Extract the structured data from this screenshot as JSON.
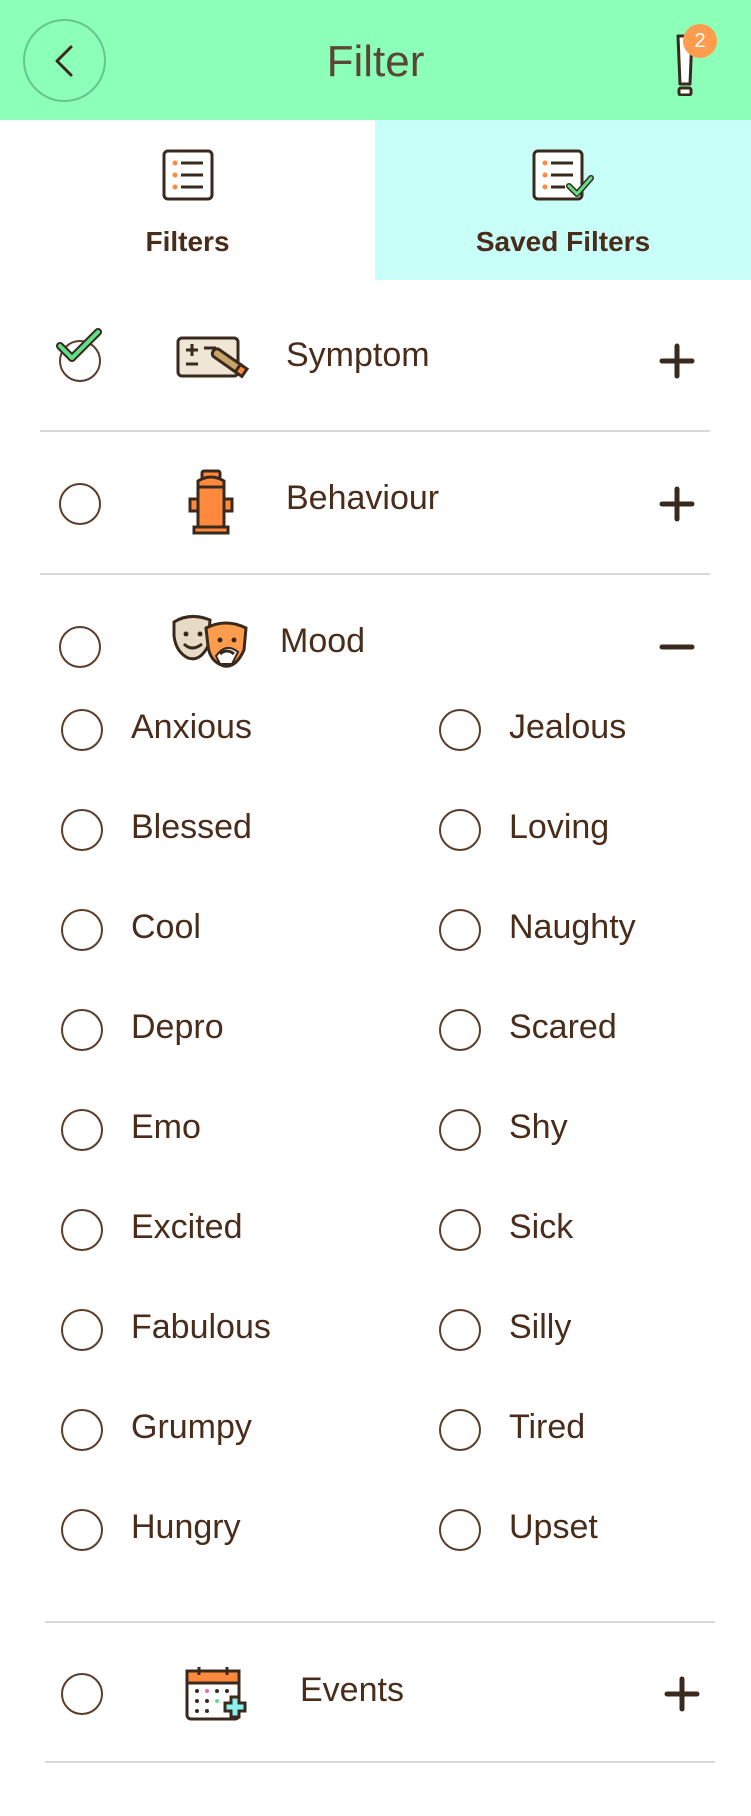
{
  "header": {
    "title": "Filter",
    "alert_count": "2",
    "bg_color": "#8cffb8"
  },
  "tabs": [
    {
      "label": "Filters",
      "icon": "list-icon",
      "active": false
    },
    {
      "label": "Saved Filters",
      "icon": "list-check-icon",
      "active": true
    }
  ],
  "categories": {
    "symptom": {
      "label": "Symptom",
      "checked": true,
      "expanded": false,
      "icon": "thermometer-chart-icon"
    },
    "behaviour": {
      "label": "Behaviour",
      "checked": false,
      "expanded": false,
      "icon": "fire-hydrant-icon"
    },
    "mood": {
      "label": "Mood",
      "checked": false,
      "expanded": true,
      "icon": "pet-masks-icon"
    },
    "events": {
      "label": "Events",
      "checked": false,
      "expanded": false,
      "icon": "calendar-plus-icon"
    }
  },
  "mood_options": {
    "left": [
      "Anxious",
      "Blessed",
      "Cool",
      "Depro",
      "Emo",
      "Excited",
      "Fabulous",
      "Grumpy",
      "Hungry"
    ],
    "right": [
      "Jealous",
      "Loving",
      "Naughty",
      "Scared",
      "Shy",
      "Sick",
      "Silly",
      "Tired",
      "Upset"
    ]
  },
  "colors": {
    "accent_green": "#8cffb8",
    "saved_tab": "#c9fff9",
    "text_brown": "#4a2c1a",
    "badge_orange": "#ff9c4d",
    "check_green": "#5ee08a"
  }
}
